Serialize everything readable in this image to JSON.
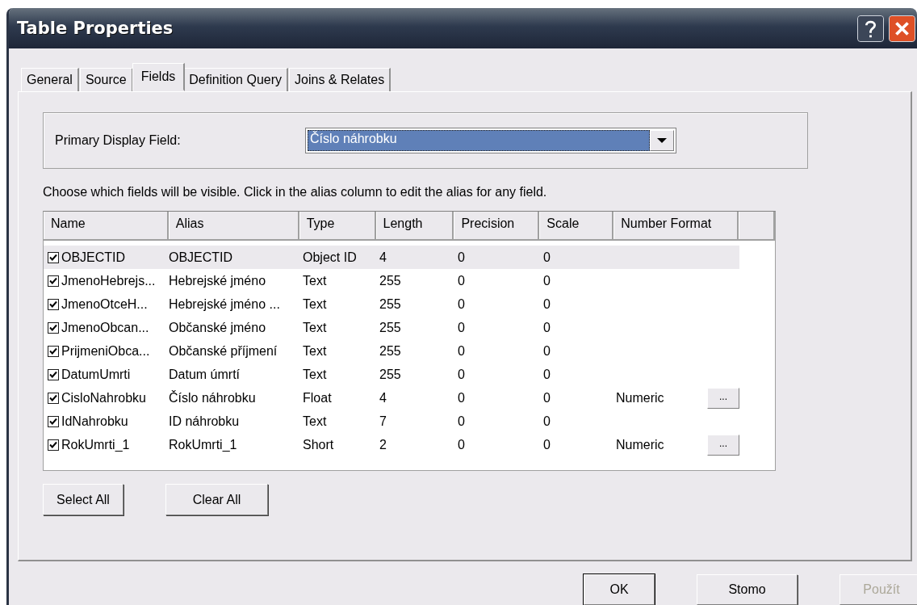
{
  "window": {
    "title": "Table Properties"
  },
  "tabs": [
    {
      "label": "General",
      "selected": false
    },
    {
      "label": "Source",
      "selected": false
    },
    {
      "label": "Fields",
      "selected": true
    },
    {
      "label": "Definition Query",
      "selected": false
    },
    {
      "label": "Joins & Relates",
      "selected": false
    }
  ],
  "primary_display_field": {
    "label": "Primary Display Field:",
    "value": "Číslo náhrobku"
  },
  "instructions": "Choose which fields will be visible. Click in the alias column to edit the alias for any field.",
  "table": {
    "columns": [
      "Name",
      "Alias",
      "Type",
      "Length",
      "Precision",
      "Scale",
      "Number Format"
    ],
    "rows": [
      {
        "checked": true,
        "selected": true,
        "cells": [
          "OBJECTID",
          "OBJECTID",
          "Object ID",
          "4",
          "0",
          "0"
        ]
      },
      {
        "checked": true,
        "selected": false,
        "cells": [
          "JmenoHebrejs...",
          "Hebrejské jméno",
          "Text",
          "255",
          "0",
          "0"
        ]
      },
      {
        "checked": true,
        "selected": false,
        "cells": [
          "JmenoOtceH...",
          "Hebrejské jméno ...",
          "Text",
          "255",
          "0",
          "0"
        ]
      },
      {
        "checked": true,
        "selected": false,
        "cells": [
          "JmenoObcan...",
          "Občanské jméno",
          "Text",
          "255",
          "0",
          "0"
        ]
      },
      {
        "checked": true,
        "selected": false,
        "cells": [
          "PrijmeniObca...",
          "Občanské příjmení",
          "Text",
          "255",
          "0",
          "0"
        ]
      },
      {
        "checked": true,
        "selected": false,
        "cells": [
          "DatumUmrti",
          "Datum úmrtí",
          "Text",
          "255",
          "0",
          "0"
        ]
      },
      {
        "checked": true,
        "selected": false,
        "cells": [
          "CisloNahrobku",
          "Číslo náhrobku",
          "Float",
          "4",
          "0",
          "0",
          "Numeric"
        ],
        "format_button": "..."
      },
      {
        "checked": true,
        "selected": false,
        "cells": [
          "IdNahrobku",
          "ID náhrobku",
          "Text",
          "7",
          "0",
          "0"
        ]
      },
      {
        "checked": true,
        "selected": false,
        "cells": [
          "RokUmrti_1",
          "RokUmrti_1",
          "Short",
          "2",
          "0",
          "0",
          "Numeric"
        ],
        "format_button": "..."
      }
    ]
  },
  "table_buttons": [
    "Select All",
    "Clear All"
  ],
  "dialog_buttons": [
    {
      "label": "OK",
      "disabled": false,
      "default": true
    },
    {
      "label": "Stomo",
      "disabled": false,
      "default": false
    },
    {
      "label": "Použít",
      "disabled": true,
      "default": false
    }
  ]
}
